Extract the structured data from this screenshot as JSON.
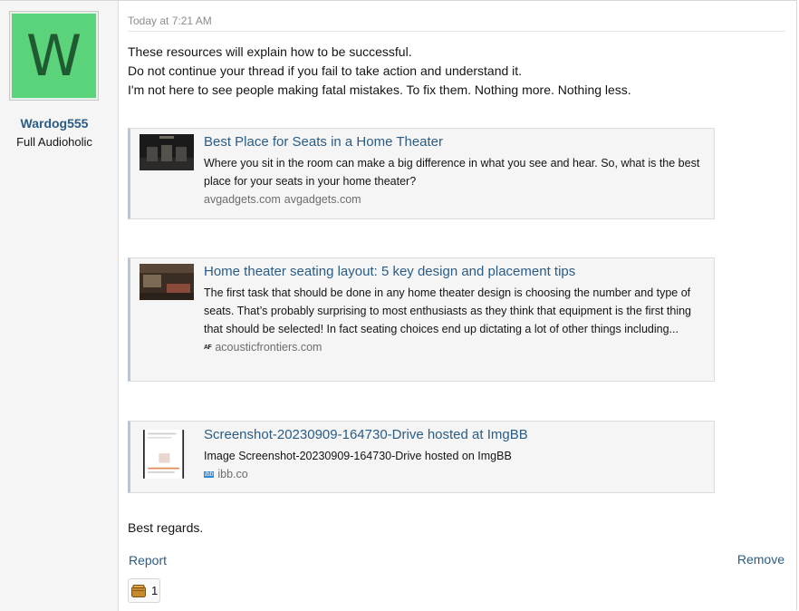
{
  "user": {
    "avatar_letter": "W",
    "avatar_color": "#5bd37a",
    "name": "Wardog555",
    "title": "Full Audioholic"
  },
  "post": {
    "timestamp": "Today at 7:21 AM",
    "lines": [
      "These resources will explain how to be successful.",
      "Do not continue your thread if you fail to take action and understand it.",
      "I'm not here to see people making fatal mistakes. To fix them. Nothing more. Nothing less."
    ],
    "cards": [
      {
        "title": "Best Place for Seats in a Home Theater",
        "description": "Where you sit in the room can make a big difference in what you see and hear. So, what is the best place for your seats in your home theater?",
        "favicon_alt": "avgadgets.com",
        "site": "avgadgets.com"
      },
      {
        "title": "Home theater seating layout: 5 key design and placement tips",
        "description": "The first task that should be done in any home theater design is choosing the number and type of seats. That’s probably surprising to most enthusiasts as they think that equipment is the first thing that should be selected! In fact seating choices end up dictating a lot of other things including...",
        "favicon_text": "AF",
        "site": "acousticfrontiers.com"
      },
      {
        "title": "Screenshot-20230909-164730-Drive hosted at ImgBB",
        "description": "Image Screenshot-20230909-164730-Drive hosted on ImgBB",
        "favicon_text": "ibb",
        "site": "ibb.co"
      }
    ],
    "closing": "Best regards."
  },
  "actions": {
    "report": "Report",
    "remove": "Remove",
    "reaction_count": "1"
  },
  "colors": {
    "link": "#2a5c86",
    "card_bg": "#f5f5f5",
    "card_border_left": "#b6c8d8"
  }
}
